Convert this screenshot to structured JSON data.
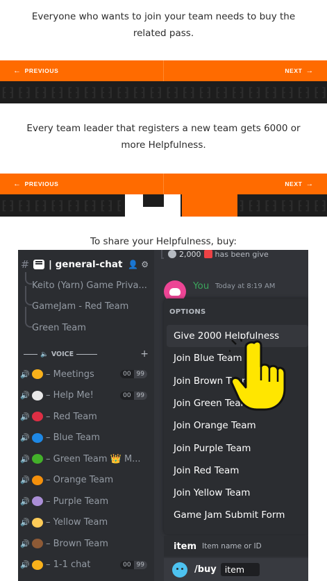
{
  "sections": [
    {
      "text": "Everyone who wants to join your team needs to buy the related pass."
    },
    {
      "text": "Every team leader that registers a new team gets 6000 or more Helpfulness."
    },
    {
      "text": "To share your Helpfulness, buy:"
    }
  ],
  "nav": {
    "prev_label": "PREVIOUS",
    "next_label": "NEXT",
    "prev_arrow": "←",
    "next_arrow": "→",
    "color": "#ff6b00"
  },
  "discord": {
    "active_channel": "| general-chat",
    "threads": [
      "Keito (Yarn) Game Priva...",
      "GameJam - Red Team",
      "Green Team"
    ],
    "voice_category": "VOICE",
    "voice_channels": [
      {
        "name": "– Meetings",
        "emoji": "heart-hands",
        "color": "#f9b11b",
        "counts": [
          "00",
          "99"
        ]
      },
      {
        "name": "– Help Me!",
        "emoji": "calendar",
        "color": "#e8e8e8",
        "counts": [
          "00",
          "99"
        ]
      },
      {
        "name": "– Red Team",
        "emoji": "red-circle",
        "color": "#dd2e44"
      },
      {
        "name": "– Blue Team",
        "emoji": "blue-circle",
        "color": "#1e88e5"
      },
      {
        "name": "– Green Team 👑 M...",
        "emoji": "green-circle",
        "color": "#43b02a"
      },
      {
        "name": "– Orange Team",
        "emoji": "orange-circle",
        "color": "#f4900c"
      },
      {
        "name": "– Purple Team",
        "emoji": "purple-circle",
        "color": "#aa8ed6"
      },
      {
        "name": "– Yellow Team",
        "emoji": "yellow-circle",
        "color": "#fdcb58"
      },
      {
        "name": "– Brown Team",
        "emoji": "brown-circle",
        "color": "#8d5a36"
      },
      {
        "name": "– 1-1 chat",
        "emoji": "face",
        "color": "#f9b11b",
        "counts": [
          "00",
          "99"
        ]
      }
    ],
    "top_message": "2,000",
    "top_message_tail": "has been give",
    "author": "You",
    "timestamp": "Today at 8:19 AM",
    "options_header": "OPTIONS",
    "options": [
      "Give 2000 Helpfulness",
      "Join Blue Team",
      "Join Brown Team",
      "Join Green Team",
      "Join Orange Team",
      "Join Purple Team",
      "Join Red Team",
      "Join Yellow Team",
      "Game Jam Submit Form"
    ],
    "cmd_arg_label": "item",
    "cmd_arg_hint": "Item name or ID",
    "command": "/buy",
    "arg_value": "item"
  }
}
